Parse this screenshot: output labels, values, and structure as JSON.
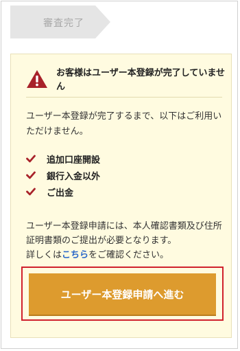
{
  "step": {
    "label": "審査完了"
  },
  "alert": {
    "title": "お客様はユーザー本登録が完了していません",
    "icon": "warning-triangle-icon",
    "icon_color": "#a8222a"
  },
  "description": "ユーザー本登録が完了するまで、以下はご利用いただけません。",
  "restrictions": [
    {
      "label": "追加口座開設",
      "icon": "check-icon"
    },
    {
      "label": "銀行入金以外",
      "icon": "check-icon"
    },
    {
      "label": "ご出金",
      "icon": "check-icon"
    }
  ],
  "note": {
    "line1": "ユーザー本登録申請には、本人確認書類及び住所証明書類のご提出が必要となります。",
    "prefix": "詳しくは",
    "link": "こちら",
    "suffix": "をご確認ください。"
  },
  "cta": {
    "label": "ユーザー本登録申請へ進む",
    "color": "#dd9b2e"
  },
  "colors": {
    "card_bg": "#fffbe0",
    "highlight_border": "#d0202c",
    "link": "#2a68c9",
    "check": "#a8222a"
  }
}
